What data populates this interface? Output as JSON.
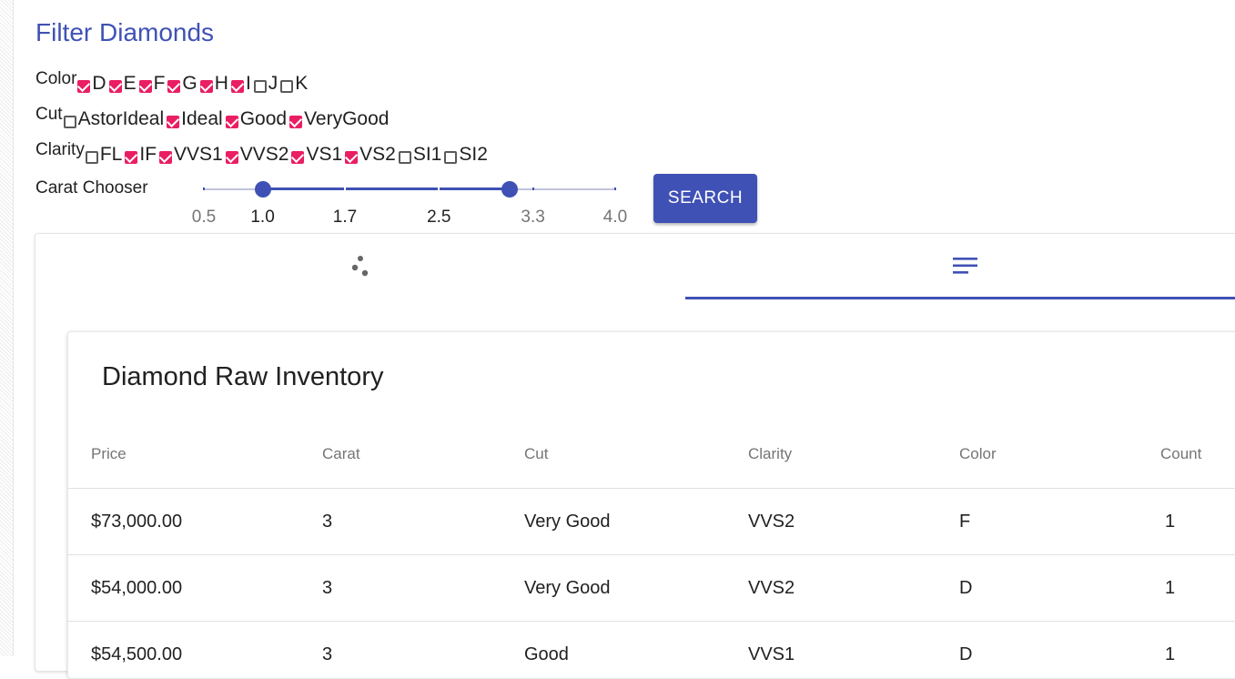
{
  "title": "Filter Diamonds",
  "colors": {
    "accent": "#3f51b5",
    "checkbox": "#e91e63"
  },
  "color_filter": {
    "label": "Color",
    "options": [
      {
        "label": "D",
        "checked": true
      },
      {
        "label": "E",
        "checked": true
      },
      {
        "label": "F",
        "checked": true
      },
      {
        "label": "G",
        "checked": true
      },
      {
        "label": "H",
        "checked": true
      },
      {
        "label": "I",
        "checked": true
      },
      {
        "label": "J",
        "checked": false
      },
      {
        "label": "K",
        "checked": false
      }
    ]
  },
  "cut_filter": {
    "label": "Cut",
    "options": [
      {
        "label": "AstorIdeal",
        "checked": false
      },
      {
        "label": "Ideal",
        "checked": true
      },
      {
        "label": "Good",
        "checked": true
      },
      {
        "label": "VeryGood",
        "checked": true
      }
    ]
  },
  "clarity_filter": {
    "label": "Clarity",
    "options": [
      {
        "label": "FL",
        "checked": false
      },
      {
        "label": "IF",
        "checked": true
      },
      {
        "label": "VVS1",
        "checked": true
      },
      {
        "label": "VVS2",
        "checked": true
      },
      {
        "label": "VS1",
        "checked": true
      },
      {
        "label": "VS2",
        "checked": true
      },
      {
        "label": "SI1",
        "checked": false
      },
      {
        "label": "SI2",
        "checked": false
      }
    ]
  },
  "carat": {
    "label": "Carat Chooser",
    "min": 0.5,
    "max": 4.0,
    "selected": [
      1.0,
      3.1
    ],
    "marks": [
      "0.5",
      "1.0",
      "1.7",
      "2.5",
      "3.3",
      "4.0"
    ]
  },
  "search_button": "SEARCH",
  "tabs": [
    {
      "icon": "scatter-plot-icon",
      "active": false
    },
    {
      "icon": "list-icon",
      "active": true
    }
  ],
  "inventory": {
    "title": "Diamond Raw Inventory",
    "columns": [
      "Price",
      "Carat",
      "Cut",
      "Clarity",
      "Color",
      "Count"
    ],
    "rows": [
      [
        "$73,000.00",
        "3",
        "Very Good",
        "VVS2",
        "F",
        "1"
      ],
      [
        "$54,000.00",
        "3",
        "Very Good",
        "VVS2",
        "D",
        "1"
      ],
      [
        "$54,500.00",
        "3",
        "Good",
        "VVS1",
        "D",
        "1"
      ]
    ]
  }
}
